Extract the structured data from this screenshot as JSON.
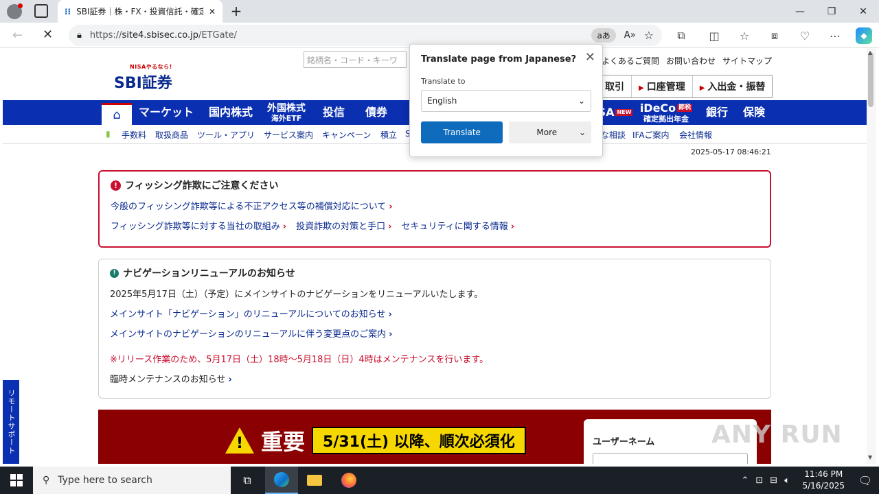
{
  "browser": {
    "tab_title": "SBI証券｜株・FX・投資信託・確定拠",
    "new_tab_symbol": "+",
    "url_prefix": "https://",
    "url_domain": "site4.sbisec.co.jp",
    "url_path": "/ETGate/",
    "translate_badge": "aあ",
    "read_aloud": "A»"
  },
  "window_controls": {
    "minimize": "—",
    "restore": "❐",
    "close": "✕"
  },
  "site": {
    "logo_tagline": "NISAやるなら!",
    "logo_text": "SBI証券",
    "search_placeholder": "銘柄名・コード・キーワ",
    "top_links": [
      "よくあるご質問",
      "お問い合わせ",
      "サイトマップ"
    ],
    "account_buttons": [
      "取引",
      "口座管理",
      "入出金・振替"
    ],
    "nav": [
      {
        "label": "マーケット",
        "sub": ""
      },
      {
        "label": "国内株式",
        "sub": ""
      },
      {
        "label": "外国株式",
        "sub": "海外ETF"
      },
      {
        "label": "投信",
        "sub": ""
      },
      {
        "label": "債券",
        "sub": ""
      },
      {
        "label": "SA",
        "sub": ""
      },
      {
        "label": "iDeCo",
        "sub": "確定拠出年金"
      },
      {
        "label": "銀行",
        "sub": ""
      },
      {
        "label": "保険",
        "sub": ""
      }
    ],
    "nav_new_badge": "NEW",
    "nav_ideco_badge": "節税",
    "subnav": [
      "手数料",
      "取扱商品",
      "ツール・アプリ",
      "サービス案内",
      "キャンペーン",
      "積立",
      "S"
    ],
    "subnav_right": [
      "な相談",
      "IFAご案内",
      "会社情報"
    ],
    "datetime": "2025-05-17 08:46:21"
  },
  "phishing_box": {
    "title": "フィッシング詐欺にご注意ください",
    "links_row1": [
      "今般のフィッシング詐欺等による不正アクセス等の補償対応について"
    ],
    "links_row2": [
      "フィッシング詐欺等に対する当社の取組み",
      "投資詐欺の対策と手口",
      "セキュリティに関する情報"
    ]
  },
  "nav_notice": {
    "title": "ナビゲーションリニューアルのお知らせ",
    "text": "2025年5月17日（土）（予定）にメインサイトのナビゲーションをリニューアルいたします。",
    "link1": "メインサイト「ナビゲーション」のリニューアルについてのお知らせ",
    "link2": "メインサイトのナビゲーションのリニューアルに伴う変更点のご案内",
    "warning": "※リリース作業のため、5月17日（土）18時～5月18日（日）4時はメンテナンスを行います。",
    "link3": "臨時メンテナンスのお知らせ"
  },
  "banner": {
    "important": "重要",
    "deadline": "5/31(土) 以降、順次必須化"
  },
  "login": {
    "username_label": "ユーザーネーム"
  },
  "remote_support": "リモートサポート",
  "watermark": "ANY RUN",
  "translate_popup": {
    "title": "Translate page from Japanese?",
    "translate_to_label": "Translate to",
    "language": "English",
    "translate_button": "Translate",
    "more_button": "More"
  },
  "taskbar": {
    "search_placeholder": "Type here to search",
    "time": "11:46 PM",
    "date": "5/16/2025"
  }
}
